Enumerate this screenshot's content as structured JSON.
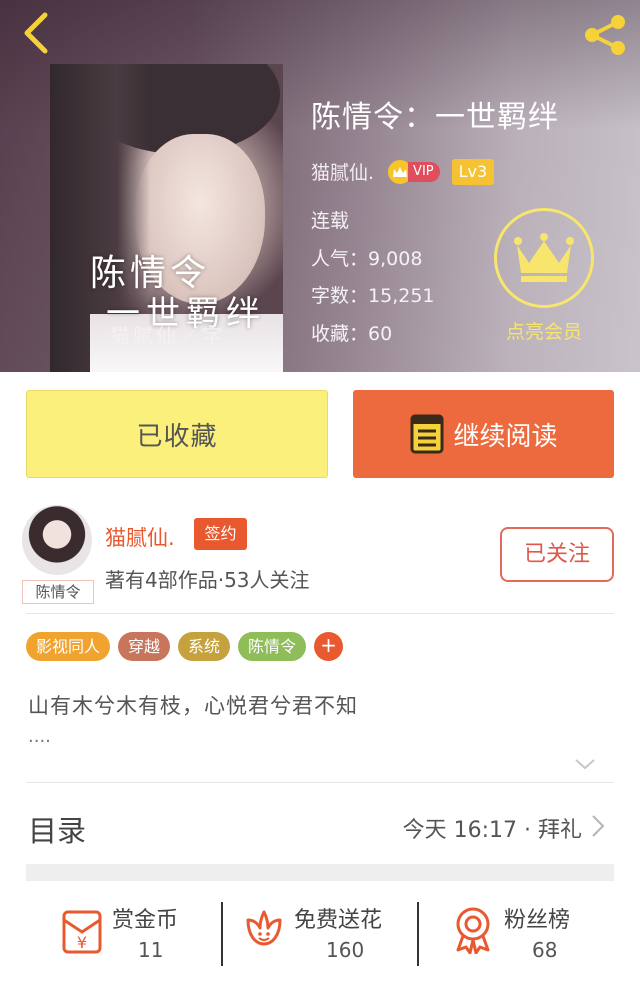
{
  "nav": {
    "back_icon": "chevron-left-icon",
    "share_icon": "share-icon"
  },
  "cover": {
    "title_line1": "陈情令",
    "title_line2": "一世羁绊",
    "author_line": "猫腻仙／字"
  },
  "book": {
    "title": "陈情令：一世羁绊",
    "author": "猫腻仙.",
    "vip_label": "VIP",
    "level": "Lv3",
    "status": "连载",
    "popularity_label": "人气：",
    "popularity": "9,008",
    "words_label": "字数：",
    "words": "15,251",
    "favorites_label": "收藏：",
    "favorites": "60"
  },
  "member": {
    "label": "点亮会员",
    "icon": "crown-icon"
  },
  "actions": {
    "collect_label": "已收藏",
    "read_label": "继续阅读"
  },
  "author": {
    "name": "猫腻仙.",
    "badge": "签约",
    "avatar_tag": "陈情令",
    "meta": "著有4部作品·53人关注",
    "follow_label": "已关注"
  },
  "tags": [
    {
      "label": "影视同人",
      "color": "#f1a330"
    },
    {
      "label": "穿越",
      "color": "#c7765b"
    },
    {
      "label": "系统",
      "color": "#c6a23e"
    },
    {
      "label": "陈情令",
      "color": "#8ebd5a"
    }
  ],
  "tag_add_label": "+",
  "description": {
    "text": "山有木兮木有枝，心悦君兮君不知",
    "more": "...."
  },
  "toc": {
    "title": "目录",
    "latest": "今天 16:17 · 拜礼"
  },
  "bottom": {
    "reward_label": "赏金币",
    "reward_value": "11",
    "flower_label": "免费送花",
    "flower_value": "160",
    "fans_label": "粉丝榜",
    "fans_value": "68"
  },
  "colors": {
    "accent": "#e8592f",
    "collect_bg": "#fbf07c",
    "read_bg": "#ec6a3d",
    "gold": "#f7e56e"
  }
}
